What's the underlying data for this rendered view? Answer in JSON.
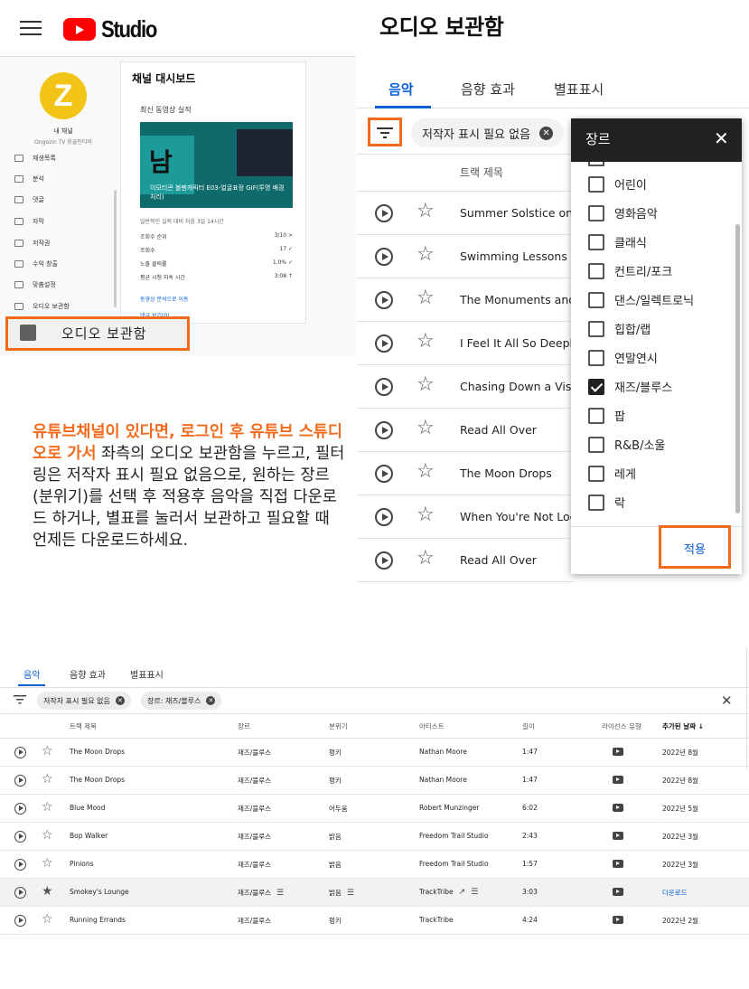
{
  "header": {
    "logo_text": "Studio",
    "page_title": "오디오 보관함"
  },
  "sidebar": {
    "channel_name": "내 채널",
    "channel_sub": "Ongozin TV 옹골진티비",
    "items": [
      {
        "label": "재생목록",
        "icon": "playlist-icon"
      },
      {
        "label": "분석",
        "icon": "analytics-icon"
      },
      {
        "label": "댓글",
        "icon": "comments-icon"
      },
      {
        "label": "자막",
        "icon": "subtitles-icon"
      },
      {
        "label": "저작권",
        "icon": "copyright-icon"
      },
      {
        "label": "수익 창출",
        "icon": "dollar-icon"
      },
      {
        "label": "맞춤설정",
        "icon": "wand-icon"
      },
      {
        "label": "오디오 보관함",
        "icon": "audio-library-icon"
      }
    ],
    "highlight_label": "오디오 보관함"
  },
  "dashboard": {
    "title": "채널 대시보드",
    "latest": "최신 동영상 실적",
    "thumb_caption": "이모티콘 볼펜캐릭터 E03-얼굴표정 GIF(투명 배경 처리)",
    "thumb_glyph": "남",
    "period": "일반적인 실적 대비 처음 3일 14시간",
    "stats": [
      {
        "label": "조회수 순위",
        "value": "3/10 >"
      },
      {
        "label": "조회수",
        "value": "17 ✓"
      },
      {
        "label": "노출 클릭률",
        "value": "1.0% ✓"
      },
      {
        "label": "평균 시청 지속 시간",
        "value": "3:08 ↑"
      }
    ],
    "link": "동영상 분석으로 이동",
    "link2": "댓글 보기(0)"
  },
  "description": {
    "highlight": "유튜브채널이 있다면, 로그인 후 유튜브 스튜디오로 가서",
    "rest": " 좌측의 오디오 보관함을 누르고, 필터링은 저작자 표시 필요 없음으로, 원하는 장르(분위기)를 선택 후 적용후 음악을 직접 다운로드 하거나, 별표를 눌러서 보관하고 필요할 때 언제든 다운로드하세요."
  },
  "top_tabs": [
    "음악",
    "음향 효과",
    "별표표시"
  ],
  "filter_chip": "저작자 표시 필요 없음",
  "track_header": "트랙 제목",
  "tracks": [
    "Summer Solstice on t",
    "Swimming Lessons",
    "The Monuments and",
    "I Feel It All So Deeply",
    "Chasing Down a Visio",
    "Read All Over",
    "The Moon Drops",
    "When You're Not Look",
    "Read All Over"
  ],
  "genre_panel": {
    "title": "장르",
    "options": [
      {
        "label": "어린이",
        "checked": false
      },
      {
        "label": "영화음악",
        "checked": false
      },
      {
        "label": "클래식",
        "checked": false
      },
      {
        "label": "컨트리/포크",
        "checked": false
      },
      {
        "label": "댄스/일렉트로닉",
        "checked": false
      },
      {
        "label": "힙합/랩",
        "checked": false
      },
      {
        "label": "연말연시",
        "checked": false
      },
      {
        "label": "재즈/블루스",
        "checked": true
      },
      {
        "label": "팝",
        "checked": false
      },
      {
        "label": "R&B/소울",
        "checked": false
      },
      {
        "label": "레게",
        "checked": false
      },
      {
        "label": "락",
        "checked": false
      }
    ],
    "apply": "적용"
  },
  "bottom": {
    "tabs": [
      "음악",
      "음향 효과",
      "별표표시"
    ],
    "chips": [
      "저작자 표시 필요 없음",
      "장르: 재즈/블루스"
    ],
    "columns": [
      "트랙 제목",
      "장르",
      "분위기",
      "아티스트",
      "길이",
      "라이선스 유형",
      "추가된 날짜 ↓"
    ],
    "rows": [
      {
        "title": "The Moon Drops",
        "genre": "재즈/블루스",
        "mood": "펑키",
        "artist": "Nathan Moore",
        "length": "1:47",
        "added": "2022년 8월",
        "starred": false
      },
      {
        "title": "The Moon Drops",
        "genre": "재즈/블루스",
        "mood": "펑키",
        "artist": "Nathan Moore",
        "length": "1:47",
        "added": "2022년 8월",
        "starred": false
      },
      {
        "title": "Blue Mood",
        "genre": "재즈/블루스",
        "mood": "어두움",
        "artist": "Robert Munzinger",
        "length": "6:02",
        "added": "2022년 5월",
        "starred": false
      },
      {
        "title": "Bop Walker",
        "genre": "재즈/블루스",
        "mood": "밝음",
        "artist": "Freedom Trail Studio",
        "length": "2:43",
        "added": "2022년 3월",
        "starred": false
      },
      {
        "title": "Pinions",
        "genre": "재즈/블루스",
        "mood": "밝음",
        "artist": "Freedom Trail Studio",
        "length": "1:57",
        "added": "2022년 3월",
        "starred": false
      },
      {
        "title": "Smokey's Lounge",
        "genre": "재즈/블루스",
        "mood": "밝음",
        "artist": "TrackTribe",
        "length": "3:03",
        "added": "다운로드",
        "starred": true
      },
      {
        "title": "Running Errands",
        "genre": "재즈/블루스",
        "mood": "펑키",
        "artist": "TrackTribe",
        "length": "4:24",
        "added": "2022년 2월",
        "starred": false
      }
    ]
  },
  "colors": {
    "accent": "#065fd4",
    "highlight_border": "#f26b1d",
    "youtube_red": "#ff0000"
  }
}
